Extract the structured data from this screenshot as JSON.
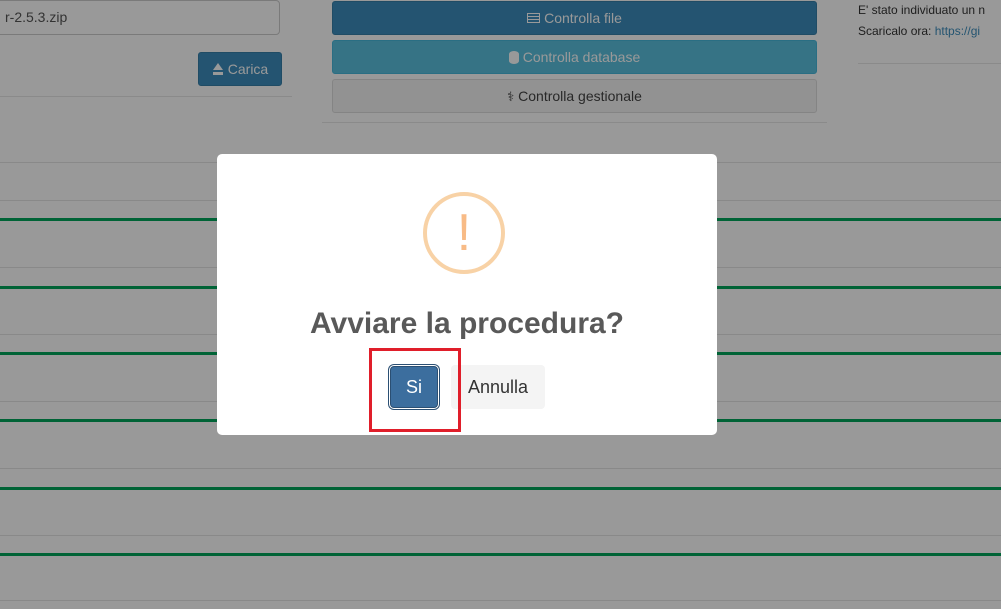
{
  "upload": {
    "file_name": "r-2.5.3.zip",
    "upload_button": "Carica"
  },
  "checks": {
    "file_button": "Controlla file",
    "database_button": "Controlla database",
    "management_button": "Controlla gestionale"
  },
  "notice": {
    "line1": "E' stato individuato un n",
    "line2_prefix": "Scaricalo ora: ",
    "line2_link": "https://gi"
  },
  "modal": {
    "icon": "!",
    "title": "Avviare la procedura?",
    "confirm_label": "Si",
    "cancel_label": "Annulla"
  },
  "colors": {
    "primary": "#3c8dbc",
    "info": "#5bc0de",
    "success_line": "#00a65a",
    "warning_icon": "#f8bb86",
    "highlight": "#e01e2a"
  }
}
